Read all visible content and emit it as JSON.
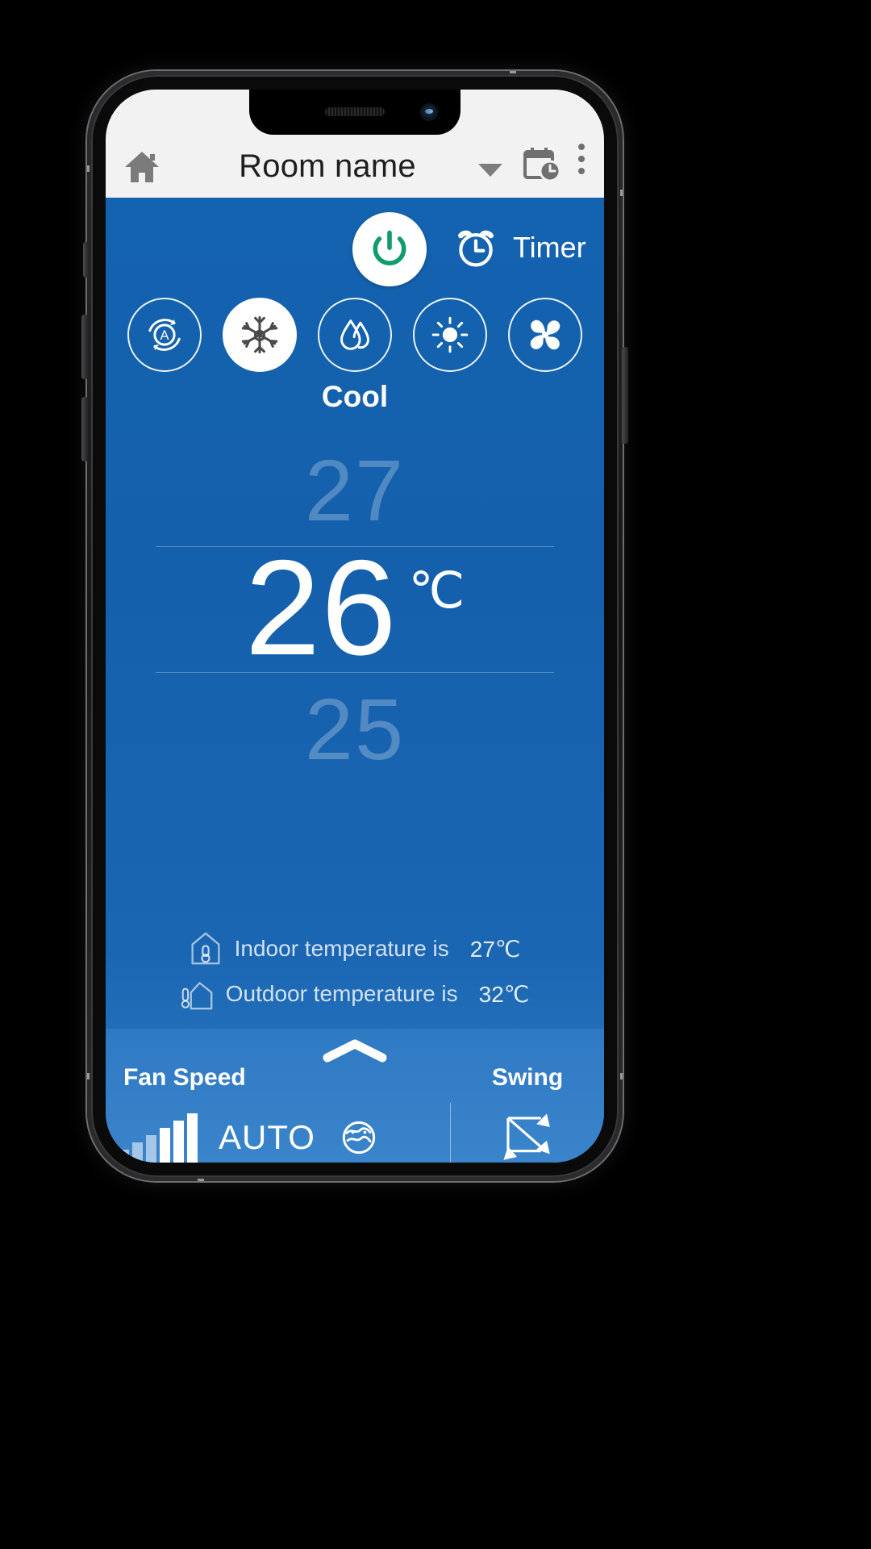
{
  "app": {
    "header": {
      "home_icon": "home-icon",
      "room_name": "Room name",
      "dropdown_icon": "chevron-down-icon",
      "schedule_icon": "calendar-clock-icon",
      "overflow_icon": "kebab-menu-icon"
    },
    "power": {
      "power_icon": "power-icon",
      "power_color": "#0f9d6e",
      "timer_icon": "alarm-clock-icon",
      "timer_label": "Timer"
    },
    "modes": {
      "selected_label": "Cool",
      "items": [
        {
          "id": "auto",
          "icon": "auto-mode-icon",
          "label": "Auto",
          "active": false
        },
        {
          "id": "cool",
          "icon": "snowflake-icon",
          "label": "Cool",
          "active": true
        },
        {
          "id": "dry",
          "icon": "water-drop-icon",
          "label": "Dry",
          "active": false
        },
        {
          "id": "heat",
          "icon": "sun-icon",
          "label": "Heat",
          "active": false
        },
        {
          "id": "fan",
          "icon": "fan-blades-icon",
          "label": "Fan",
          "active": false
        }
      ]
    },
    "temperature": {
      "above": "27",
      "current": "26",
      "unit": "℃",
      "below": "25"
    },
    "environment": [
      {
        "icon": "indoor-thermometer-icon",
        "text": "Indoor temperature is",
        "value": "27℃"
      },
      {
        "icon": "outdoor-thermometer-icon",
        "text": "Outdoor temperature is",
        "value": "32℃"
      }
    ],
    "bottom_bar": {
      "expand_icon": "chevron-up-icon",
      "fan_speed_label": "Fan Speed",
      "fan_speed_value": "AUTO",
      "fan_speed_bars_icon": "signal-bars-icon",
      "fan_auto_icon": "fan-auto-icon",
      "swing_label": "Swing",
      "swing_icon": "swing-arrows-icon"
    },
    "colors": {
      "background_blue": "#1560ac",
      "bottom_blue": "#3a84cb",
      "appbar": "#f2f2f2",
      "accent_green": "#0f9d6e",
      "white": "#ffffff"
    }
  }
}
